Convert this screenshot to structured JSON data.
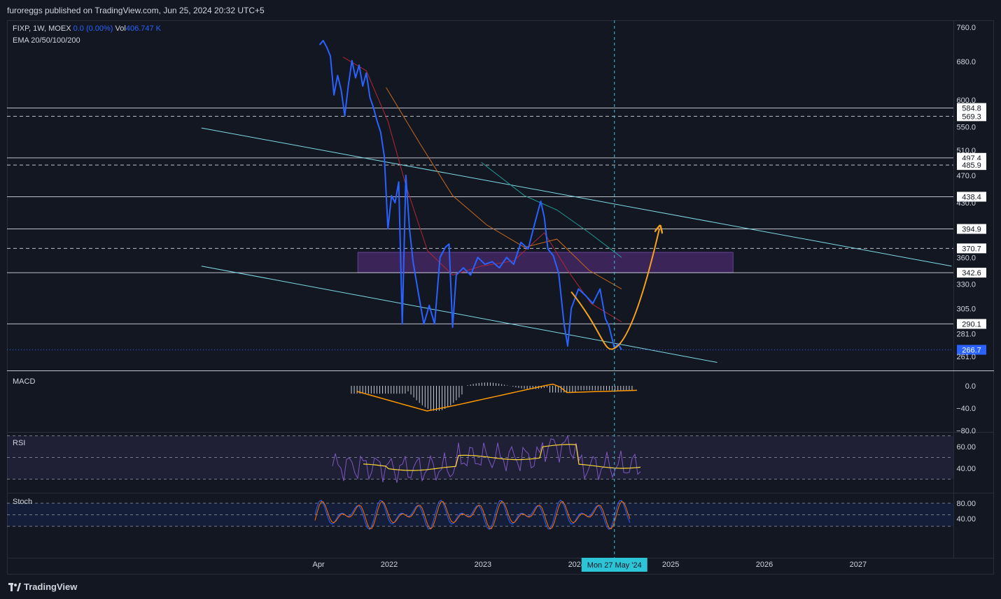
{
  "header": {
    "published": "furoreggs published on TradingView.com, Jun 25, 2024 20:32 UTC+5"
  },
  "legend": {
    "symbol": "FIXP, 1W, MOEX",
    "change": "0.0 (0.00%)",
    "vol_label": "Vol",
    "vol_value": "406.747 K",
    "ema": "EMA 20/50/100/200"
  },
  "panes": {
    "macd": "MACD",
    "rsi": "RSI",
    "stoch": "Stoch"
  },
  "footer": {
    "brand": "TradingView"
  },
  "crosshair_label": "Mon 27 May '24",
  "colors": {
    "price": "#2962ff",
    "ema20": "#b22833",
    "ema50": "#c76a1c",
    "ema100": "#1e9c96",
    "projection": "#f7a21b",
    "rsi": "#7e57c2",
    "rsi_ma": "#fdd835",
    "stoch_k": "#2962ff",
    "stoch_d": "#ff6d00",
    "zone": "#4a2a6b",
    "last_price": "#2962ff",
    "crosshair_label_bg": "#2ec4d8"
  },
  "chart_data": {
    "type": "line",
    "price_axis": {
      "ticks": [
        "760.0",
        "680.0",
        "600.0",
        "550.0",
        "510.0",
        "470.0",
        "430.0",
        "360.0",
        "330.0",
        "305.0",
        "281.0",
        "261.0"
      ]
    },
    "macd_axis": {
      "ticks": [
        "0.0",
        "−40.0",
        "−80.0"
      ]
    },
    "rsi_axis": {
      "ticks": [
        "60.00",
        "40.00"
      ]
    },
    "stoch_axis": {
      "ticks": [
        "80.00",
        "40.00"
      ]
    },
    "x_axis": {
      "ticks": [
        "Apr",
        "2022",
        "2023",
        "2024",
        "2025",
        "2026",
        "2027"
      ]
    },
    "levels": [
      {
        "label": "584.8",
        "value": 584.8,
        "style": "solid"
      },
      {
        "label": "569.3",
        "value": 569.3,
        "style": "dashed"
      },
      {
        "label": "497.4",
        "value": 497.4,
        "style": "solid"
      },
      {
        "label": "485.9",
        "value": 485.9,
        "style": "dashed"
      },
      {
        "label": "438.4",
        "value": 438.4,
        "style": "solid"
      },
      {
        "label": "394.9",
        "value": 394.9,
        "style": "solid"
      },
      {
        "label": "370.7",
        "value": 370.7,
        "style": "dashed"
      },
      {
        "label": "342.6",
        "value": 342.6,
        "style": "solid"
      },
      {
        "label": "290.1",
        "value": 290.1,
        "style": "solid"
      }
    ],
    "last_price": "266.7",
    "zone": {
      "from": 342.6,
      "to": 366.0,
      "x_start": "2021-09",
      "x_end": "2025-09"
    },
    "price_series": [
      [
        "2021-04-05",
        718
      ],
      [
        "2021-04-19",
        728
      ],
      [
        "2021-05-03",
        712
      ],
      [
        "2021-05-17",
        692
      ],
      [
        "2021-05-31",
        610
      ],
      [
        "2021-06-14",
        650
      ],
      [
        "2021-06-28",
        620
      ],
      [
        "2021-07-12",
        570
      ],
      [
        "2021-07-26",
        630
      ],
      [
        "2021-08-09",
        682
      ],
      [
        "2021-08-23",
        645
      ],
      [
        "2021-09-06",
        672
      ],
      [
        "2021-09-20",
        628
      ],
      [
        "2021-10-04",
        655
      ],
      [
        "2021-10-18",
        605
      ],
      [
        "2021-11-01",
        585
      ],
      [
        "2021-11-15",
        560
      ],
      [
        "2021-11-29",
        540
      ],
      [
        "2021-12-13",
        500
      ],
      [
        "2021-12-27",
        395
      ],
      [
        "2022-01-10",
        440
      ],
      [
        "2022-01-24",
        430
      ],
      [
        "2022-02-07",
        460
      ],
      [
        "2022-02-21",
        290
      ],
      [
        "2022-03-07",
        470
      ],
      [
        "2022-03-21",
        395
      ],
      [
        "2022-04-04",
        355
      ],
      [
        "2022-04-25",
        320
      ],
      [
        "2022-05-16",
        290
      ],
      [
        "2022-06-06",
        308
      ],
      [
        "2022-06-27",
        290
      ],
      [
        "2022-07-18",
        360
      ],
      [
        "2022-08-08",
        372
      ],
      [
        "2022-08-22",
        376
      ],
      [
        "2022-09-05",
        287
      ],
      [
        "2022-09-19",
        340
      ],
      [
        "2022-10-17",
        348
      ],
      [
        "2022-11-14",
        340
      ],
      [
        "2022-12-12",
        360
      ],
      [
        "2023-01-09",
        352
      ],
      [
        "2023-02-06",
        355
      ],
      [
        "2023-03-06",
        348
      ],
      [
        "2023-04-03",
        360
      ],
      [
        "2023-05-01",
        352
      ],
      [
        "2023-05-29",
        378
      ],
      [
        "2023-06-26",
        370
      ],
      [
        "2023-07-24",
        405
      ],
      [
        "2023-08-14",
        432
      ],
      [
        "2023-08-28",
        410
      ],
      [
        "2023-09-11",
        370
      ],
      [
        "2023-10-02",
        362
      ],
      [
        "2023-10-23",
        342
      ],
      [
        "2023-11-13",
        290
      ],
      [
        "2023-11-27",
        270
      ],
      [
        "2023-12-11",
        305
      ],
      [
        "2024-01-08",
        325
      ],
      [
        "2024-02-05",
        318
      ],
      [
        "2024-03-04",
        310
      ],
      [
        "2024-04-01",
        325
      ],
      [
        "2024-04-22",
        295
      ],
      [
        "2024-05-06",
        288
      ],
      [
        "2024-05-27",
        268
      ],
      [
        "2024-06-10",
        272
      ],
      [
        "2024-06-24",
        266.7
      ]
    ],
    "ema20": [
      [
        "2021-07-05",
        690
      ],
      [
        "2021-10-04",
        660
      ],
      [
        "2021-12-27",
        560
      ],
      [
        "2022-03-07",
        455
      ],
      [
        "2022-05-30",
        368
      ],
      [
        "2022-09-05",
        340
      ],
      [
        "2022-12-26",
        350
      ],
      [
        "2023-05-01",
        356
      ],
      [
        "2023-08-28",
        390
      ],
      [
        "2023-11-27",
        345
      ],
      [
        "2024-02-26",
        310
      ],
      [
        "2024-06-24",
        292
      ]
    ],
    "ema50": [
      [
        "2021-12-20",
        625
      ],
      [
        "2022-05-02",
        520
      ],
      [
        "2022-09-05",
        440
      ],
      [
        "2023-01-16",
        400
      ],
      [
        "2023-06-12",
        372
      ],
      [
        "2023-10-16",
        382
      ],
      [
        "2024-02-19",
        345
      ],
      [
        "2024-06-24",
        325
      ]
    ],
    "ema100": [
      [
        "2022-12-26",
        490
      ],
      [
        "2023-06-12",
        440
      ],
      [
        "2023-10-16",
        420
      ],
      [
        "2024-02-19",
        390
      ],
      [
        "2024-06-24",
        360
      ]
    ],
    "projection": [
      [
        "2023-12-11",
        322
      ],
      [
        "2024-04-15",
        282
      ],
      [
        "2024-05-27",
        268
      ],
      [
        "2024-09-02",
        300
      ],
      [
        "2024-11-18",
        394.9
      ]
    ],
    "channel_upper": [
      [
        "2020-01-01",
        548
      ],
      [
        "2027-12-31",
        350
      ]
    ],
    "channel_lower": [
      [
        "2020-01-01",
        350
      ],
      [
        "2025-07-01",
        256
      ]
    ],
    "crosshair_x": "2024-05-27"
  }
}
